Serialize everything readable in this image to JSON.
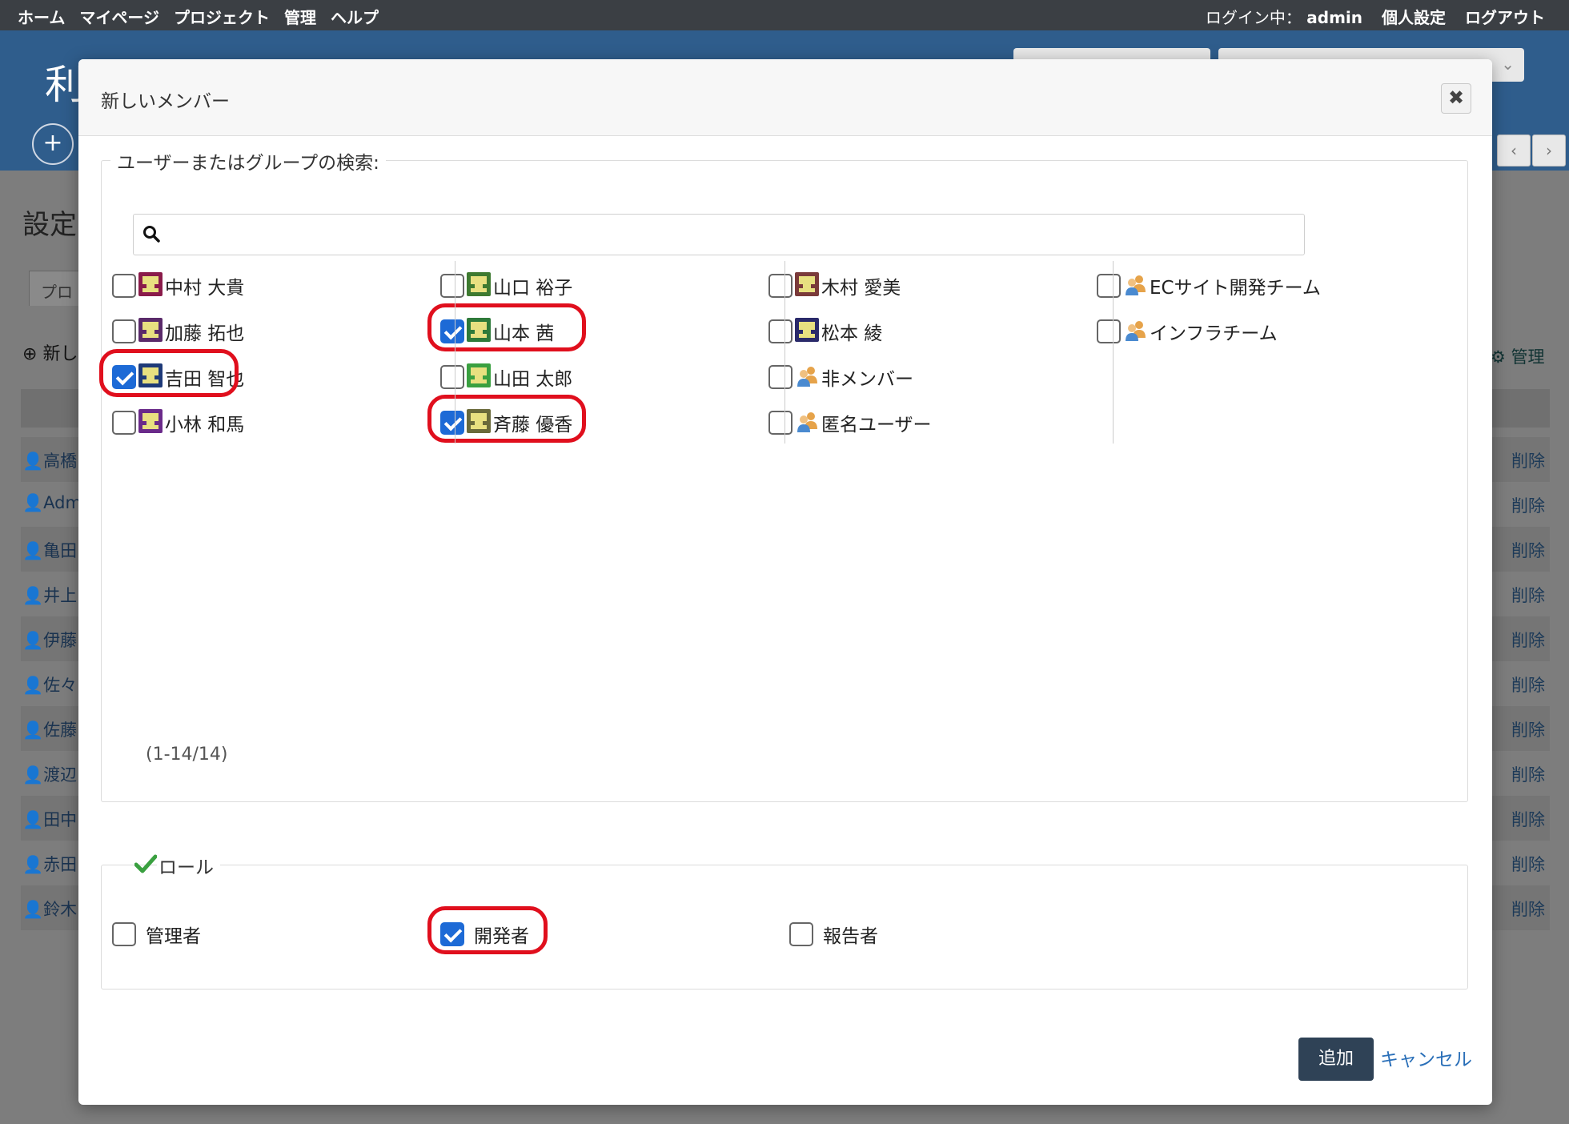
{
  "topnav": {
    "left": [
      "ホーム",
      "マイページ",
      "プロジェクト",
      "管理",
      "ヘルプ"
    ],
    "login_label": "ログイン中：",
    "login_user": "admin",
    "right": [
      "個人設定",
      "ログアウト"
    ]
  },
  "background": {
    "project_title_partial": "利",
    "plus": "+",
    "heading_partial": "設定",
    "tab_partial": "プロ",
    "new_partial": "新し",
    "manage": "管理",
    "users_partial": [
      "高橋",
      "Adm",
      "亀田",
      "井上",
      "伊藤",
      "佐々",
      "佐藤",
      "渡辺",
      "田中",
      "赤田",
      "鈴木"
    ],
    "delete_label": "削除"
  },
  "modal": {
    "title": "新しいメンバー",
    "close": "✖",
    "search_legend": "ユーザーまたはグループの検索:",
    "search_value": "",
    "principals": [
      [
        {
          "name": "中村 大貴",
          "checked": false,
          "type": "user",
          "color": "#8a1b4a"
        },
        {
          "name": "加藤 拓也",
          "checked": false,
          "type": "user",
          "color": "#5a2a6a"
        },
        {
          "name": "吉田 智也",
          "checked": true,
          "type": "user",
          "color": "#1e3a78"
        },
        {
          "name": "小林 和馬",
          "checked": false,
          "type": "user",
          "color": "#6a2a8a"
        }
      ],
      [
        {
          "name": "山口 裕子",
          "checked": false,
          "type": "user",
          "color": "#3e7a30"
        },
        {
          "name": "山本 茜",
          "checked": true,
          "type": "user",
          "color": "#2e7a3a"
        },
        {
          "name": "山田 太郎",
          "checked": false,
          "type": "user",
          "color": "#3aa040"
        },
        {
          "name": "斉藤 優香",
          "checked": true,
          "type": "user",
          "color": "#6a6a3a"
        }
      ],
      [
        {
          "name": "木村 愛美",
          "checked": false,
          "type": "user",
          "color": "#7a3a3a"
        },
        {
          "name": "松本 綾",
          "checked": false,
          "type": "user",
          "color": "#2a2a6a"
        },
        {
          "name": "非メンバー",
          "checked": false,
          "type": "group"
        },
        {
          "name": "匿名ユーザー",
          "checked": false,
          "type": "group"
        }
      ],
      [
        {
          "name": "ECサイト開発チーム",
          "checked": false,
          "type": "group"
        },
        {
          "name": "インフラチーム",
          "checked": false,
          "type": "group"
        }
      ]
    ],
    "count": "(1-14/14)",
    "roles_legend": "ロール",
    "roles": [
      {
        "name": "管理者",
        "checked": false
      },
      {
        "name": "開発者",
        "checked": true
      },
      {
        "name": "報告者",
        "checked": false
      }
    ],
    "add_button": "追加",
    "cancel_link": "キャンセル"
  },
  "colors": {
    "highlight": "#e00f1d",
    "checkbox_checked": "#1d6ad6",
    "primary_button": "#2f4256",
    "link": "#2a6fb8",
    "header_band": "#2f5d8c",
    "topbar": "#3b3f44"
  }
}
